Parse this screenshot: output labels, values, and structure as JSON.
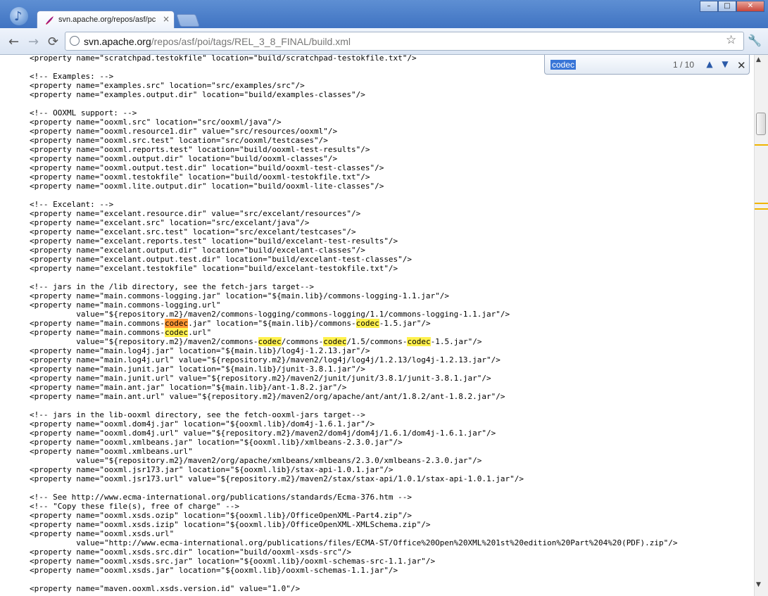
{
  "window": {
    "tab_title": "svn.apache.org/repos/asf/pc",
    "tab_close": "×",
    "minimize": "–",
    "maximize": "□",
    "close": "✕"
  },
  "toolbar": {
    "back": "←",
    "forward": "→",
    "reload": "⟳",
    "url_host": "svn.apache.org",
    "url_path": "/repos/asf/poi/tags/REL_3_8_FINAL/build.xml",
    "star": "☆",
    "wrench": "🔧"
  },
  "find": {
    "query": "codec",
    "count": "1 / 10",
    "prev": "▲",
    "next": "▼",
    "close": "✕"
  },
  "icons": {
    "app": "chrome-app-icon",
    "favicon": "apache-feather-icon",
    "lock": "page-info-icon"
  },
  "highlight": {
    "match": "#fff14e",
    "active": "#ff9632"
  },
  "code_lines": [
    "<property name=\"scratchpad.testokfile\" location=\"build/scratchpad-testokfile.txt\"/>",
    "",
    "<!-- Examples: -->",
    "<property name=\"examples.src\" location=\"src/examples/src\"/>",
    "<property name=\"examples.output.dir\" location=\"build/examples-classes\"/>",
    "",
    "<!-- OOXML support: -->",
    "<property name=\"ooxml.src\" location=\"src/ooxml/java\"/>",
    "<property name=\"ooxml.resource1.dir\" value=\"src/resources/ooxml\"/>",
    "<property name=\"ooxml.src.test\" location=\"src/ooxml/testcases\"/>",
    "<property name=\"ooxml.reports.test\" location=\"build/ooxml-test-results\"/>",
    "<property name=\"ooxml.output.dir\" location=\"build/ooxml-classes\"/>",
    "<property name=\"ooxml.output.test.dir\" location=\"build/ooxml-test-classes\"/>",
    "<property name=\"ooxml.testokfile\" location=\"build/ooxml-testokfile.txt\"/>",
    "<property name=\"ooxml.lite.output.dir\" location=\"build/ooxml-lite-classes\"/>",
    "",
    "<!-- Excelant: -->",
    "<property name=\"excelant.resource.dir\" value=\"src/excelant/resources\"/>",
    "<property name=\"excelant.src\" location=\"src/excelant/java\"/>",
    "<property name=\"excelant.src.test\" location=\"src/excelant/testcases\"/>",
    "<property name=\"excelant.reports.test\" location=\"build/excelant-test-results\"/>",
    "<property name=\"excelant.output.dir\" location=\"build/excelant-classes\"/>",
    "<property name=\"excelant.output.test.dir\" location=\"build/excelant-test-classes\"/>",
    "<property name=\"excelant.testokfile\" location=\"build/excelant-testokfile.txt\"/>",
    "",
    "<!-- jars in the /lib directory, see the fetch-jars target-->",
    "<property name=\"main.commons-logging.jar\" location=\"${main.lib}/commons-logging-1.1.jar\"/>",
    "<property name=\"main.commons-logging.url\"",
    "          value=\"${repository.m2}/maven2/commons-logging/commons-logging/1.1/commons-logging-1.1.jar\"/>",
    "<property name=\"main.commons-codec.jar\" location=\"${main.lib}/commons-codec-1.5.jar\"/>",
    "<property name=\"main.commons-codec.url\"",
    "          value=\"${repository.m2}/maven2/commons-codec/commons-codec/1.5/commons-codec-1.5.jar\"/>",
    "<property name=\"main.log4j.jar\" location=\"${main.lib}/log4j-1.2.13.jar\"/>",
    "<property name=\"main.log4j.url\" value=\"${repository.m2}/maven2/log4j/log4j/1.2.13/log4j-1.2.13.jar\"/>",
    "<property name=\"main.junit.jar\" location=\"${main.lib}/junit-3.8.1.jar\"/>",
    "<property name=\"main.junit.url\" value=\"${repository.m2}/maven2/junit/junit/3.8.1/junit-3.8.1.jar\"/>",
    "<property name=\"main.ant.jar\" location=\"${main.lib}/ant-1.8.2.jar\"/>",
    "<property name=\"main.ant.url\" value=\"${repository.m2}/maven2/org/apache/ant/ant/1.8.2/ant-1.8.2.jar\"/>",
    "",
    "<!-- jars in the lib-ooxml directory, see the fetch-ooxml-jars target-->",
    "<property name=\"ooxml.dom4j.jar\" location=\"${ooxml.lib}/dom4j-1.6.1.jar\"/>",
    "<property name=\"ooxml.dom4j.url\" value=\"${repository.m2}/maven2/dom4j/dom4j/1.6.1/dom4j-1.6.1.jar\"/>",
    "<property name=\"ooxml.xmlbeans.jar\" location=\"${ooxml.lib}/xmlbeans-2.3.0.jar\"/>",
    "<property name=\"ooxml.xmlbeans.url\"",
    "          value=\"${repository.m2}/maven2/org/apache/xmlbeans/xmlbeans/2.3.0/xmlbeans-2.3.0.jar\"/>",
    "<property name=\"ooxml.jsr173.jar\" location=\"${ooxml.lib}/stax-api-1.0.1.jar\"/>",
    "<property name=\"ooxml.jsr173.url\" value=\"${repository.m2}/maven2/stax/stax-api/1.0.1/stax-api-1.0.1.jar\"/>",
    "",
    "<!-- See http://www.ecma-international.org/publications/standards/Ecma-376.htm -->",
    "<!-- \"Copy these file(s), free of charge\" -->",
    "<property name=\"ooxml.xsds.ozip\" location=\"${ooxml.lib}/OfficeOpenXML-Part4.zip\"/>",
    "<property name=\"ooxml.xsds.izip\" location=\"${ooxml.lib}/OfficeOpenXML-XMLSchema.zip\"/>",
    "<property name=\"ooxml.xsds.url\"",
    "          value=\"http://www.ecma-international.org/publications/files/ECMA-ST/Office%20Open%20XML%201st%20edition%20Part%204%20(PDF).zip\"/>",
    "<property name=\"ooxml.xsds.src.dir\" location=\"build/ooxml-xsds-src\"/>",
    "<property name=\"ooxml.xsds.src.jar\" location=\"${ooxml.lib}/ooxml-schemas-src-1.1.jar\"/>",
    "<property name=\"ooxml.xsds.jar\" location=\"${ooxml.lib}/ooxml-schemas-1.1.jar\"/>",
    "",
    "<property name=\"maven.ooxml.xsds.version.id\" value=\"1.0\"/>"
  ]
}
